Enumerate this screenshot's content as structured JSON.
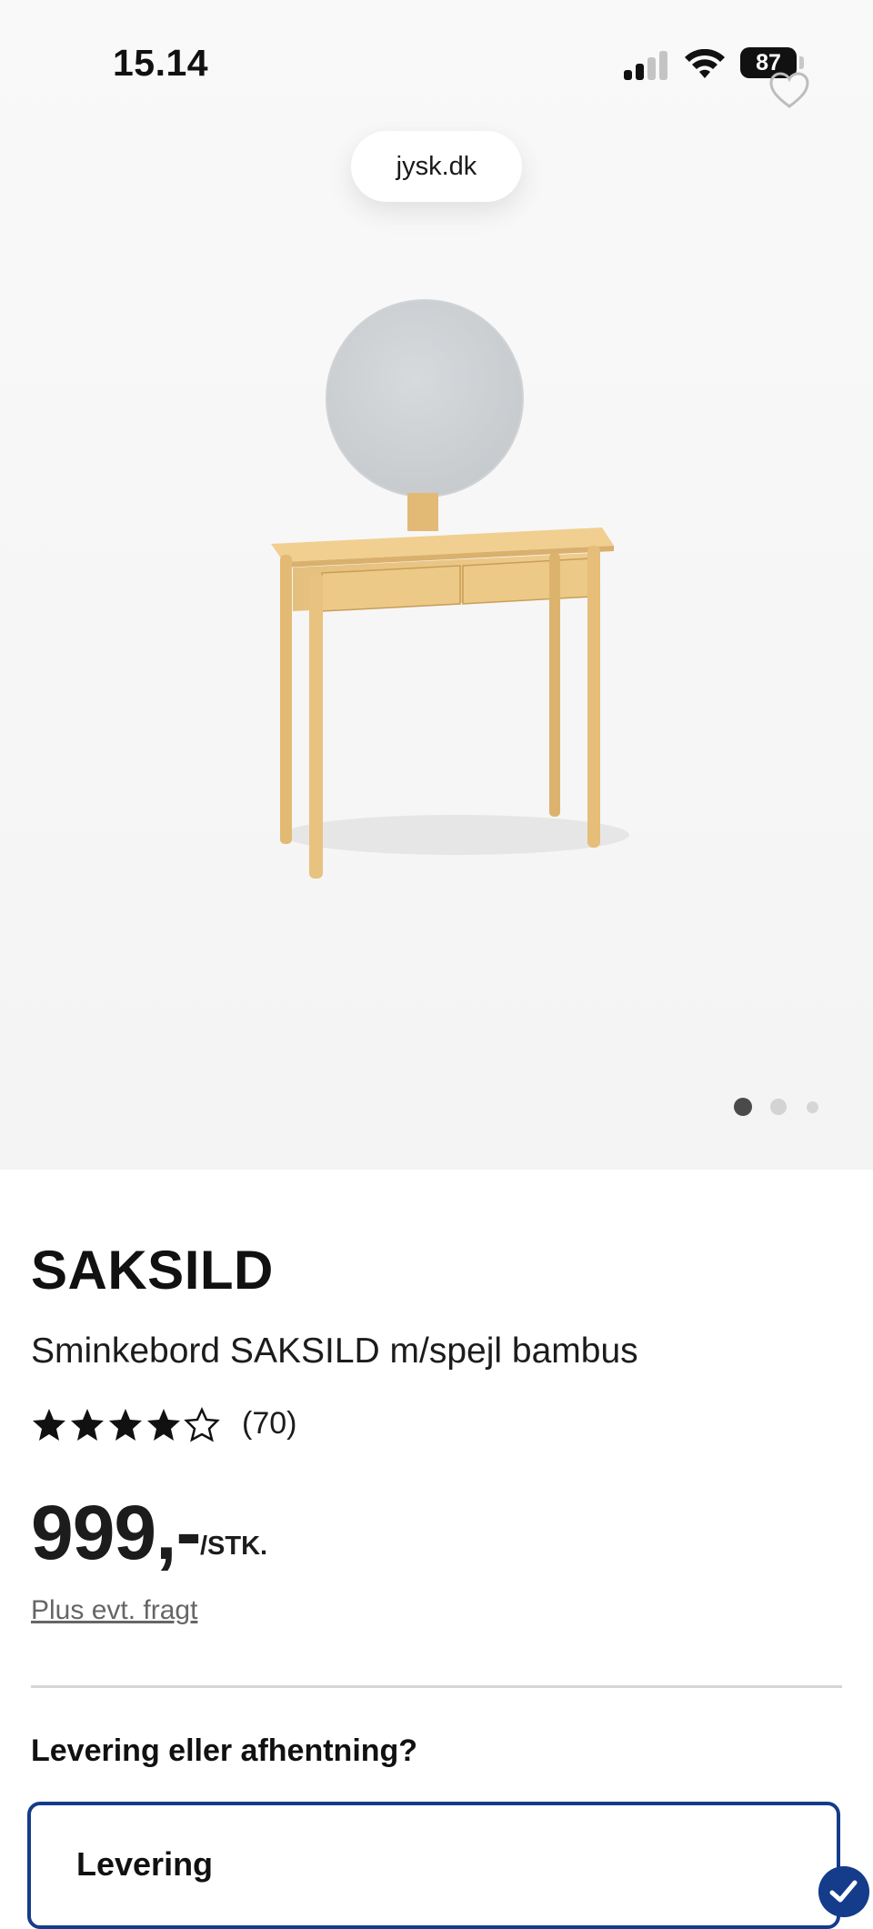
{
  "status_bar": {
    "time": "15.14",
    "battery": "87"
  },
  "browser": {
    "url": "jysk.dk"
  },
  "gallery": {
    "image_alt": "Sminkebord SAKSILD m/spejl bambus",
    "active_index": 1,
    "total": 3
  },
  "product": {
    "brand": "SAKSILD",
    "name": "Sminkebord SAKSILD m/spejl bambus",
    "rating": 4,
    "rating_max": 5,
    "review_count": "(70)",
    "price": "999,-",
    "price_unit": "/STK.",
    "freight_link": "Plus evt. fragt"
  },
  "delivery": {
    "heading": "Levering eller afhentning?",
    "option_label": "Levering",
    "option_selected": true
  },
  "colors": {
    "accent": "#143c8a",
    "text": "#111111",
    "muted": "#666666",
    "divider": "#d6d6d6",
    "hero_bg": "#f4f4f4"
  },
  "icons": {
    "favorite": "heart-outline-icon",
    "signal": "cellular-signal-icon",
    "wifi": "wifi-icon",
    "battery": "battery-icon",
    "star_filled": "star-filled-icon",
    "star_empty": "star-outline-icon",
    "check": "checkmark-icon"
  }
}
